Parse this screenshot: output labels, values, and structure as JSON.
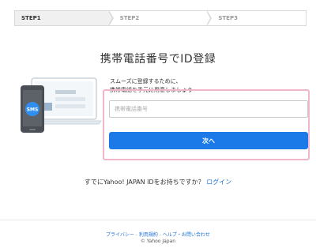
{
  "steps": [
    {
      "label": "STEP1",
      "active": true
    },
    {
      "label": "STEP2",
      "active": false
    },
    {
      "label": "STEP3",
      "active": false
    }
  ],
  "title": "携帯電話番号でID登録",
  "description": {
    "line1": "スムーズに登録するために、",
    "line2": "携帯電話を手元に用意しましょう"
  },
  "illustration": {
    "sms_label": "SMS",
    "icons": [
      "laptop-icon",
      "smartphone-icon"
    ]
  },
  "form": {
    "phone_placeholder": "携帯電話番号",
    "phone_value": "",
    "next_label": "次へ"
  },
  "existing_id": {
    "prompt": "すでにYahoo! JAPAN IDをお持ちですか？",
    "login_label": "ログイン"
  },
  "footer": {
    "privacy": "プライバシー",
    "sep1": " - ",
    "terms": "利用規約",
    "sep2": " - ",
    "help": "ヘルプ・お問い合わせ",
    "copyright": "© Yahoo Japan"
  },
  "colors": {
    "primary": "#1b7ae8",
    "panel_border": "#f0b6cc",
    "link": "#1b6fd1"
  }
}
